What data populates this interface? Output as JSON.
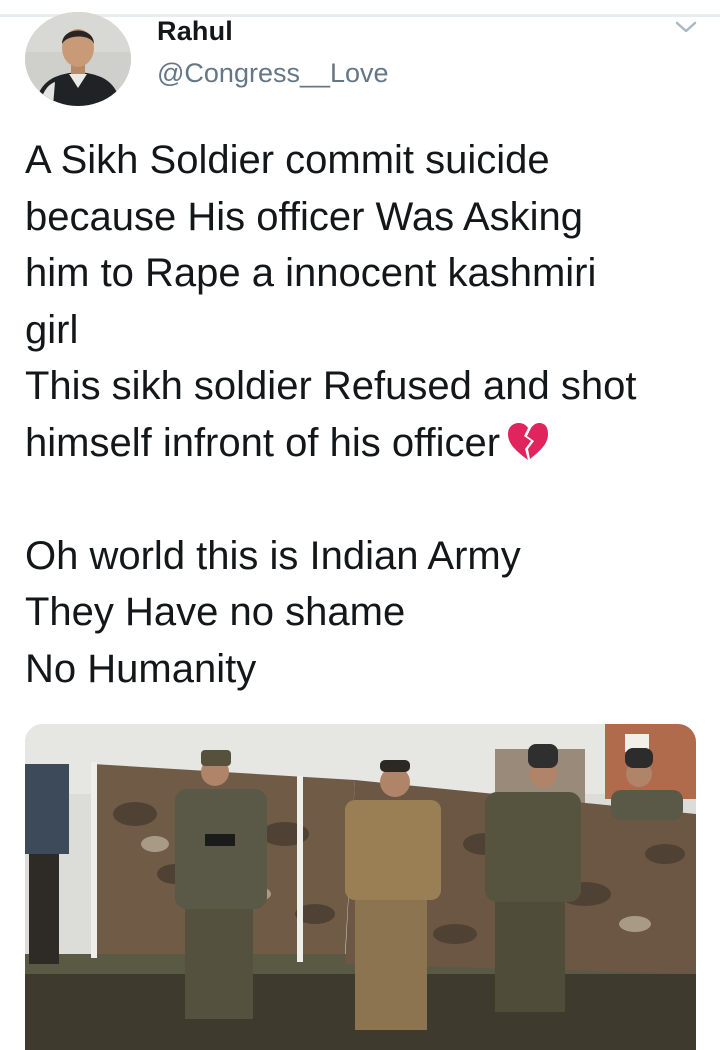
{
  "author": {
    "name": "Rahul",
    "handle": "@Congress__Love"
  },
  "tweet": {
    "lines": [
      "A Sikh Soldier commit suicide",
      "because His officer Was Asking",
      "him to Rape a innocent kashmiri",
      "girl",
      "This sikh soldier Refused and shot",
      "himself infront of his officer"
    ],
    "emoji": "broken-heart-icon",
    "lines2": [
      "Oh world this is Indian Army",
      "They Have no shame",
      "No Humanity"
    ]
  },
  "icons": {
    "menu": "chevron-down-icon"
  },
  "colors": {
    "text": "#14171a",
    "handle": "#657786",
    "divider": "#e6ecf0",
    "heart": "#e0245e"
  }
}
